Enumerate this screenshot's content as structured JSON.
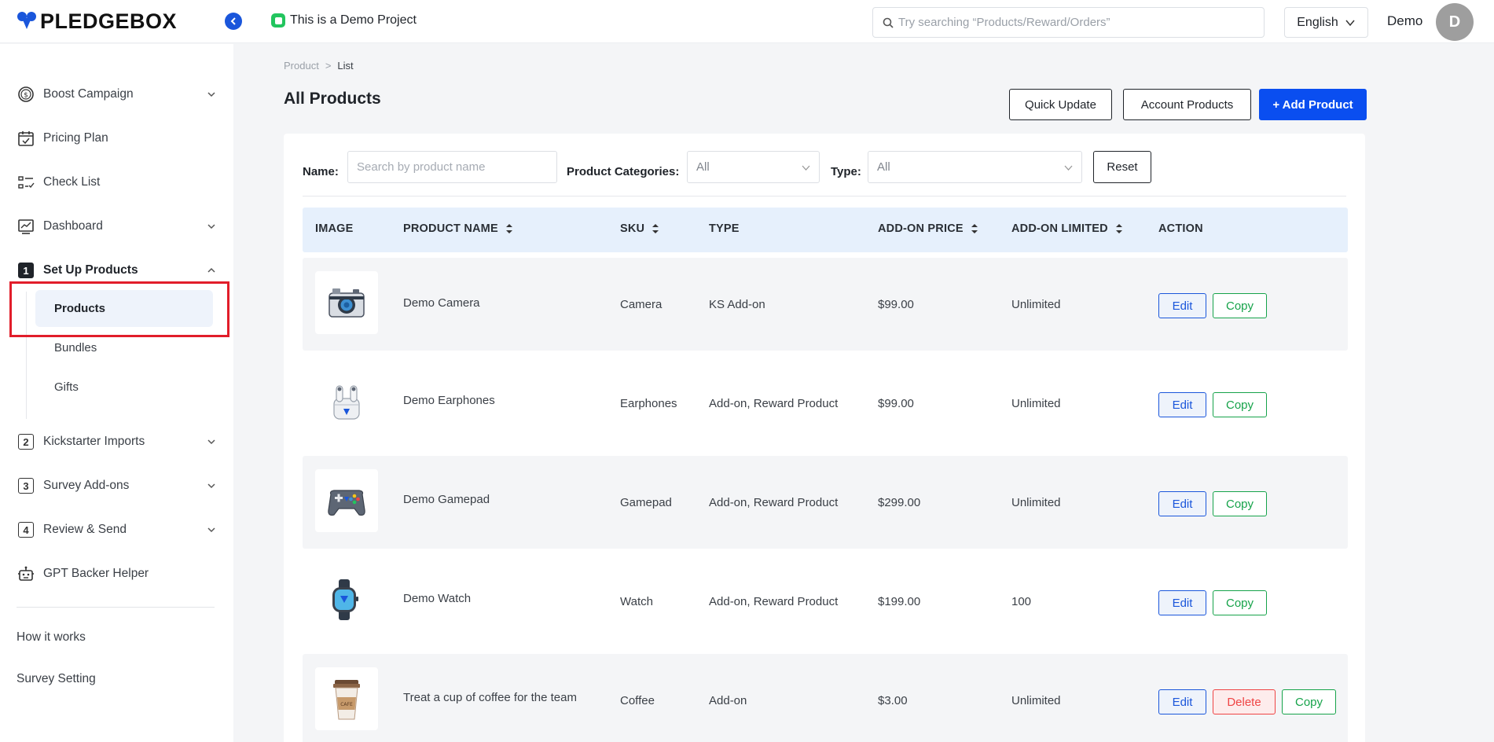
{
  "brand": {
    "name": "PLEDGEBOX"
  },
  "header": {
    "project_label": "This is a Demo Project",
    "search_placeholder": "Try searching “Products/Reward/Orders”",
    "language": "English",
    "user_name": "Demo",
    "avatar_initial": "D"
  },
  "sidebar": {
    "items": [
      {
        "label": "Boost Campaign",
        "icon": "dollar-circle-icon",
        "chevron": "down"
      },
      {
        "label": "Pricing Plan",
        "icon": "calendar-check-icon"
      },
      {
        "label": "Check List",
        "icon": "checklist-icon"
      },
      {
        "label": "Dashboard",
        "icon": "chart-icon",
        "chevron": "down"
      },
      {
        "label": "Set Up Products",
        "icon": "number-1-icon",
        "number": "1",
        "chevron": "up"
      },
      {
        "label": "Kickstarter Imports",
        "icon": "number-2-icon",
        "number": "2",
        "chevron": "down"
      },
      {
        "label": "Survey Add-ons",
        "icon": "number-3-icon",
        "number": "3",
        "chevron": "down"
      },
      {
        "label": "Review & Send",
        "icon": "number-4-icon",
        "number": "4",
        "chevron": "down"
      },
      {
        "label": "GPT Backer Helper",
        "icon": "robot-icon"
      }
    ],
    "sub_items": [
      "Products",
      "Bundles",
      "Gifts"
    ],
    "footer_links": [
      "How it works",
      "Survey Setting"
    ]
  },
  "breadcrumb": {
    "parent": "Product",
    "separator": ">",
    "current": "List"
  },
  "page": {
    "title": "All Products",
    "quick_update": "Quick Update",
    "account_products": "Account Products",
    "add_product": "+ Add Product"
  },
  "filters": {
    "name_label": "Name:",
    "name_placeholder": "Search by product name",
    "categories_label": "Product Categories:",
    "categories_value": "All",
    "type_label": "Type:",
    "type_value": "All",
    "reset": "Reset"
  },
  "table": {
    "columns": [
      "IMAGE",
      "PRODUCT NAME",
      "SKU",
      "TYPE",
      "ADD-ON PRICE",
      "ADD-ON LIMITED",
      "ACTION"
    ],
    "actions": {
      "edit": "Edit",
      "copy": "Copy",
      "delete": "Delete"
    },
    "rows": [
      {
        "image": "camera-icon",
        "name": "Demo Camera",
        "sku": "Camera",
        "type": "KS Add-on",
        "price": "$99.00",
        "limited": "Unlimited"
      },
      {
        "image": "earphones-icon",
        "name": "Demo Earphones",
        "sku": "Earphones",
        "type": "Add-on, Reward Product",
        "price": "$99.00",
        "limited": "Unlimited"
      },
      {
        "image": "gamepad-icon",
        "name": "Demo Gamepad",
        "sku": "Gamepad",
        "type": "Add-on, Reward Product",
        "price": "$299.00",
        "limited": "Unlimited"
      },
      {
        "image": "watch-icon",
        "name": "Demo Watch",
        "sku": "Watch",
        "type": "Add-on, Reward Product",
        "price": "$199.00",
        "limited": "100"
      },
      {
        "image": "coffee-cup-icon",
        "name": "Treat a cup of coffee for the team",
        "sku": "Coffee",
        "type": "Add-on",
        "price": "$3.00",
        "limited": "Unlimited"
      }
    ]
  },
  "colors": {
    "accent": "#0a4ef0",
    "highlight": "#e11d2a",
    "copy": "#16a34a",
    "delete": "#ef4444"
  }
}
